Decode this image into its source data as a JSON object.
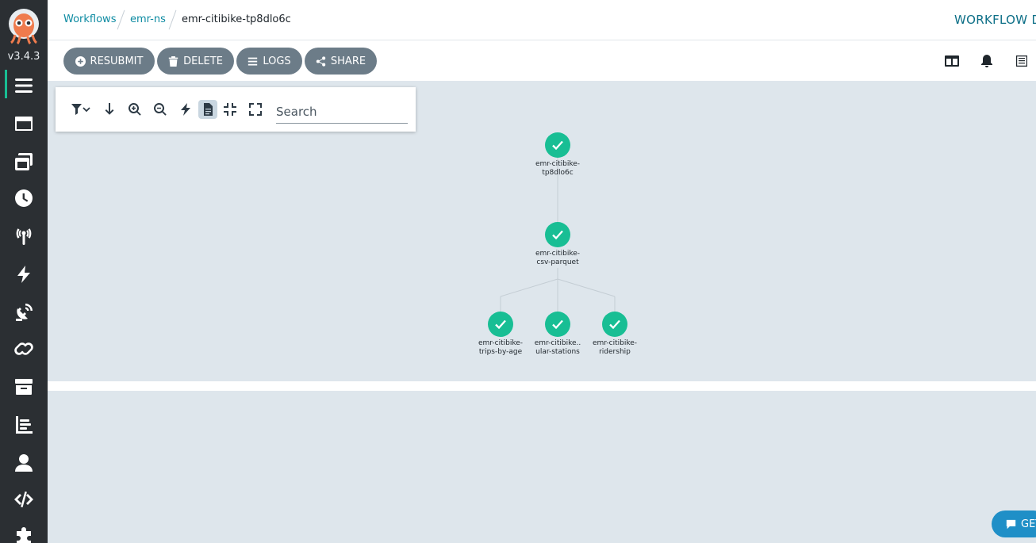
{
  "app": {
    "version": "v3.4.3"
  },
  "sidebar": {
    "items": [
      {
        "icon": "hamburger-icon",
        "active": true
      },
      {
        "icon": "window-icon"
      },
      {
        "icon": "stack-icon"
      },
      {
        "icon": "clock-icon"
      },
      {
        "icon": "broadcast-icon"
      },
      {
        "icon": "bolt-icon"
      },
      {
        "icon": "satellite-dish-icon"
      },
      {
        "icon": "link-icon"
      },
      {
        "icon": "archive-icon"
      },
      {
        "icon": "bar-chart-icon"
      },
      {
        "icon": "user-icon"
      },
      {
        "icon": "code-icon"
      },
      {
        "icon": "puzzle-icon"
      }
    ]
  },
  "breadcrumb": {
    "items": [
      "Workflows",
      "emr-ns",
      "emr-citibike-tp8dlo6c"
    ]
  },
  "header": {
    "title": "WORKFLOW DETAILS"
  },
  "toolbar": {
    "resubmit": "RESUBMIT",
    "delete": "DELETE",
    "logs": "LOGS",
    "share": "SHARE"
  },
  "graph_toolbar": {
    "search_placeholder": "Search"
  },
  "graph": {
    "nodes": [
      {
        "line1": "emr-citibike-",
        "line2": "tp8dlo6c",
        "status": "succeeded"
      },
      {
        "line1": "emr-citibike-",
        "line2": "csv-parquet",
        "status": "succeeded"
      },
      {
        "line1": "emr-citibike-",
        "line2": "trips-by-age",
        "status": "succeeded"
      },
      {
        "line1": "emr-citibike..",
        "line2": "ular-stations",
        "status": "succeeded"
      },
      {
        "line1": "emr-citibike-",
        "line2": "ridership",
        "status": "succeeded"
      }
    ]
  },
  "help": {
    "label": "GET"
  },
  "colors": {
    "success": "#18be94",
    "button": "#6c7c88",
    "sidebar": "#2b2f33",
    "link": "#0d8ba2"
  }
}
